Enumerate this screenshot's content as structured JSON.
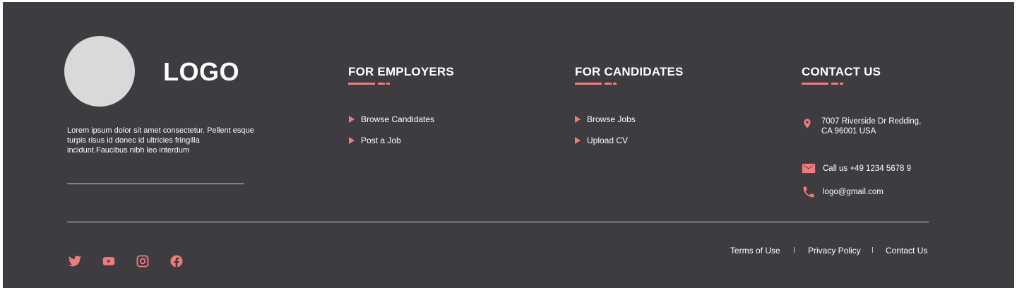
{
  "brand": {
    "logo_text": "LOGO",
    "description": "Lorem ipsum dolor sit amet consectetur. Pellent esque turpis risus id donec id ultricies fringilla incidunt.Faucibus nibh leo interdum"
  },
  "employers": {
    "title": "FOR EMPLOYERS",
    "links": [
      "Browse Candidates",
      "Post a Job"
    ]
  },
  "candidates": {
    "title": "FOR CANDIDATES",
    "links": [
      "Browse Jobs",
      "Upload CV"
    ]
  },
  "contact": {
    "title": "CONTACT US",
    "address_line1": "7007 Riverside Dr Redding,",
    "address_line2": "CA 96001 USA",
    "phone": "Call us +49 1234 5678 9",
    "email": "logo@gmail.com"
  },
  "social": {
    "icons": [
      "twitter-icon",
      "youtube-icon",
      "instagram-icon",
      "facebook-icon"
    ]
  },
  "legal": {
    "terms": "Terms of Use",
    "privacy": "Privacy Policy",
    "contact": "Contact Us"
  },
  "colors": {
    "background": "#3e3b41",
    "accent": "#f07b7b",
    "text": "#ffffff"
  }
}
